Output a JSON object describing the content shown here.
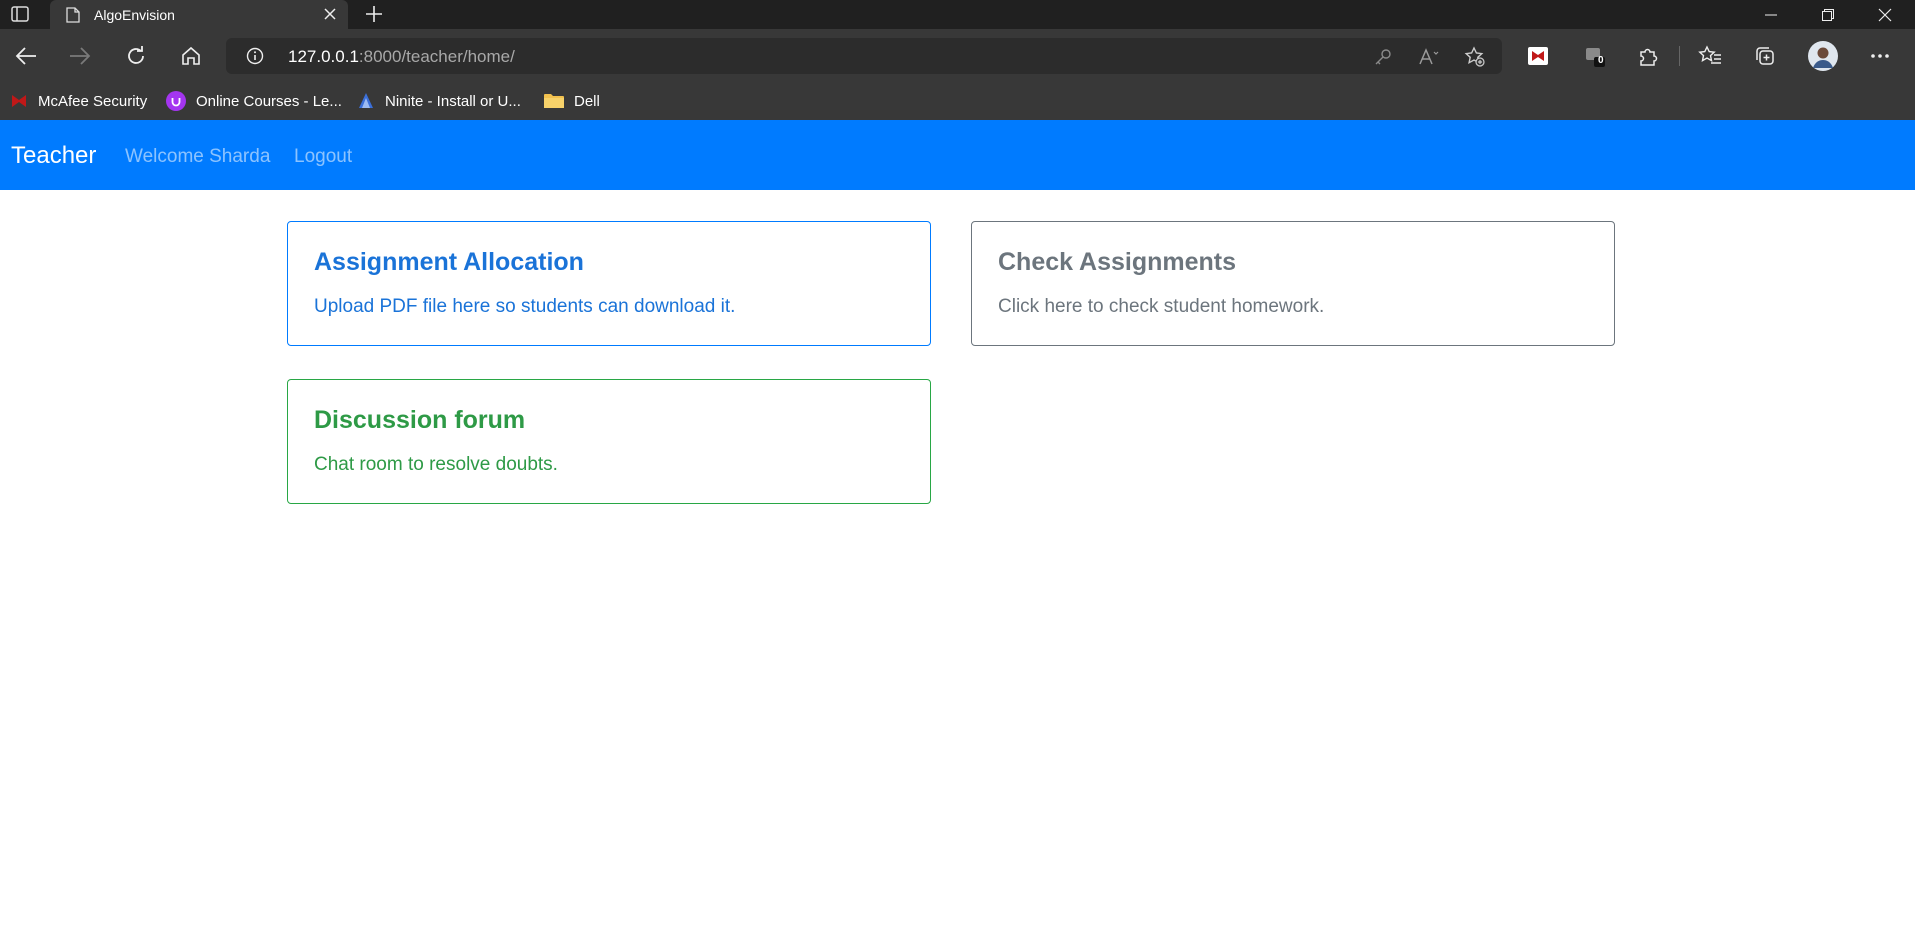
{
  "browser": {
    "tab_title": "AlgoEnvision",
    "url_host": "127.0.0.1",
    "url_rest": ":8000/teacher/home/",
    "extension_badge": "0",
    "bookmarks": [
      {
        "label": "McAfee Security",
        "icon": "mcafee-icon"
      },
      {
        "label": "Online Courses - Le...",
        "icon": "udemy-icon"
      },
      {
        "label": "Ninite - Install or U...",
        "icon": "ninite-icon"
      },
      {
        "label": "Dell",
        "icon": "folder-icon"
      }
    ]
  },
  "navbar": {
    "brand": "Teacher",
    "welcome": "Welcome Sharda",
    "logout": "Logout",
    "color": "#007bff"
  },
  "cards": {
    "assignment": {
      "title": "Assignment Allocation",
      "text": "Upload PDF file here so students can download it.",
      "color": "#007bff"
    },
    "check": {
      "title": "Check Assignments",
      "text": "Click here to check student homework.",
      "color": "#6c757d"
    },
    "forum": {
      "title": "Discussion forum",
      "text": "Chat room to resolve doubts.",
      "color": "#28a745"
    }
  }
}
